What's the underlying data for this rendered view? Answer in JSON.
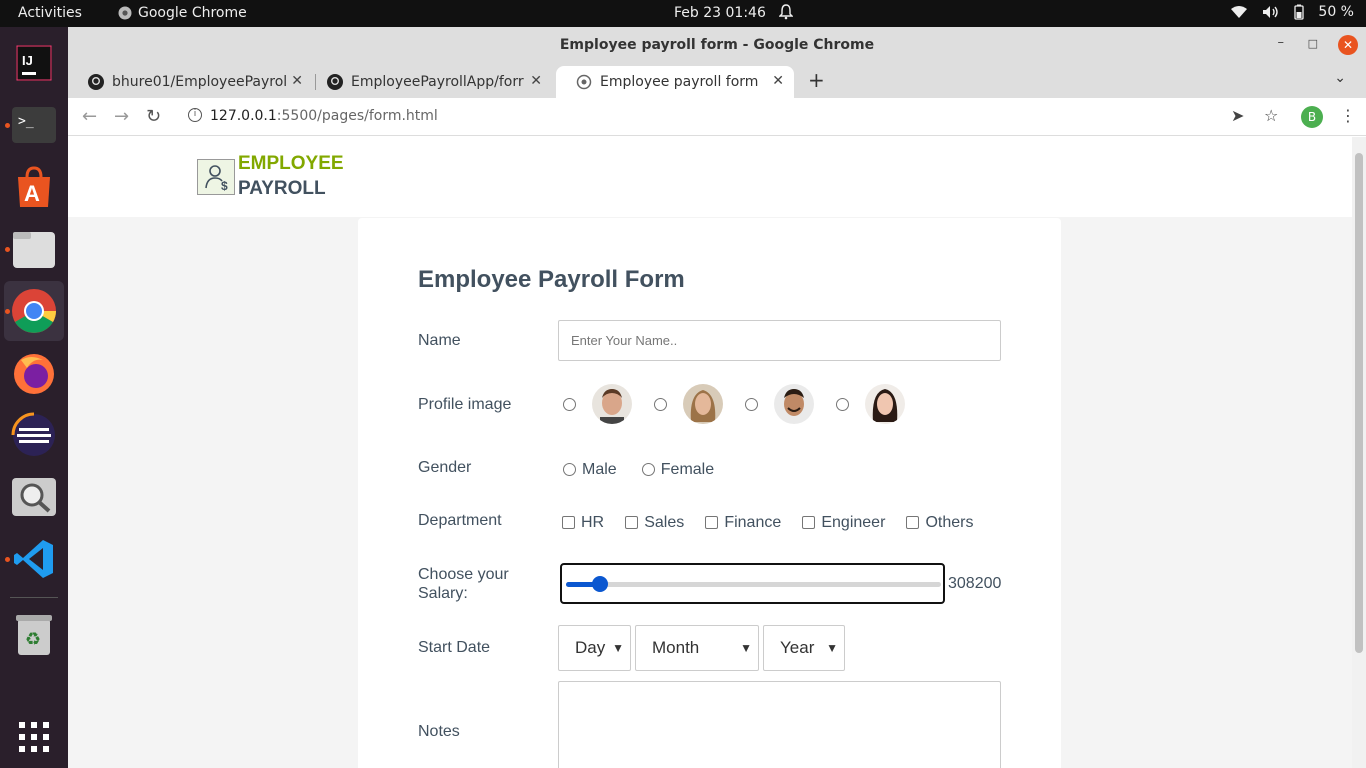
{
  "topbar": {
    "activities": "Activities",
    "app_name": "Google Chrome",
    "datetime": "Feb 23  01:46",
    "battery": "50 %"
  },
  "dock": {
    "items": [
      "intellij-icon",
      "terminal-icon",
      "software-center-icon",
      "files-icon",
      "chrome-icon",
      "firefox-icon",
      "eclipse-icon",
      "image-viewer-icon",
      "vscode-icon",
      "trash-icon",
      "app-grid-icon"
    ]
  },
  "window": {
    "title": "Employee payroll form - Google Chrome"
  },
  "tabs": [
    {
      "title": "bhure01/EmployeePayrol"
    },
    {
      "title": "EmployeePayrollApp/forr"
    },
    {
      "title": "Employee payroll form"
    }
  ],
  "address": {
    "host": "127.0.0.1",
    "rest": ":5500/pages/form.html",
    "profile_initial": "B"
  },
  "logo": {
    "line1": "EMPLOYEE",
    "line2": "PAYROLL"
  },
  "form": {
    "title": "Employee Payroll Form",
    "name_label": "Name",
    "name_placeholder": "Enter Your Name..",
    "profile_label": "Profile image",
    "gender_label": "Gender",
    "gender_options": [
      "Male",
      "Female"
    ],
    "department_label": "Department",
    "departments": [
      "HR",
      "Sales",
      "Finance",
      "Engineer",
      "Others"
    ],
    "salary_label": "Choose your Salary:",
    "salary_value": "308200",
    "salary_fraction": 0.09,
    "start_date_label": "Start Date",
    "day": "Day",
    "month": "Month",
    "year": "Year",
    "notes_label": "Notes"
  },
  "colors": {
    "brand_green": "#82a800",
    "brand_dark": "#42515f",
    "accent_blue": "#0b57d0",
    "ubuntu_orange": "#e95420"
  }
}
